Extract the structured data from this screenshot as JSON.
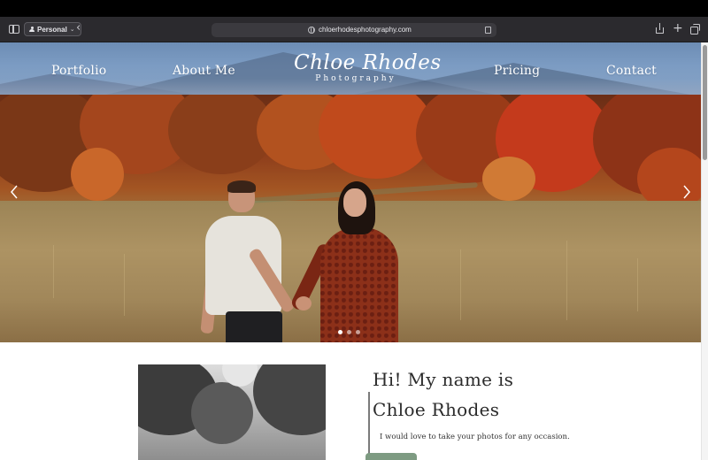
{
  "browser": {
    "profile_label": "Personal",
    "url": "chloerhodesphotography.com"
  },
  "site": {
    "nav": {
      "portfolio": "Portfolio",
      "about": "About Me",
      "pricing": "Pricing",
      "contact": "Contact"
    },
    "logo": {
      "name": "Chloe Rhodes",
      "sub": "Photography"
    }
  },
  "hero": {
    "slide_count": 3,
    "active_slide": 1
  },
  "about": {
    "heading": "Hi! My name is Chloe Rhodes",
    "text": "I would love to take your photos for any occasion."
  },
  "colors": {
    "header_sky": "#7c9cc3",
    "button_green": "#7e9b82",
    "toolbar": "#2b2a2e"
  }
}
